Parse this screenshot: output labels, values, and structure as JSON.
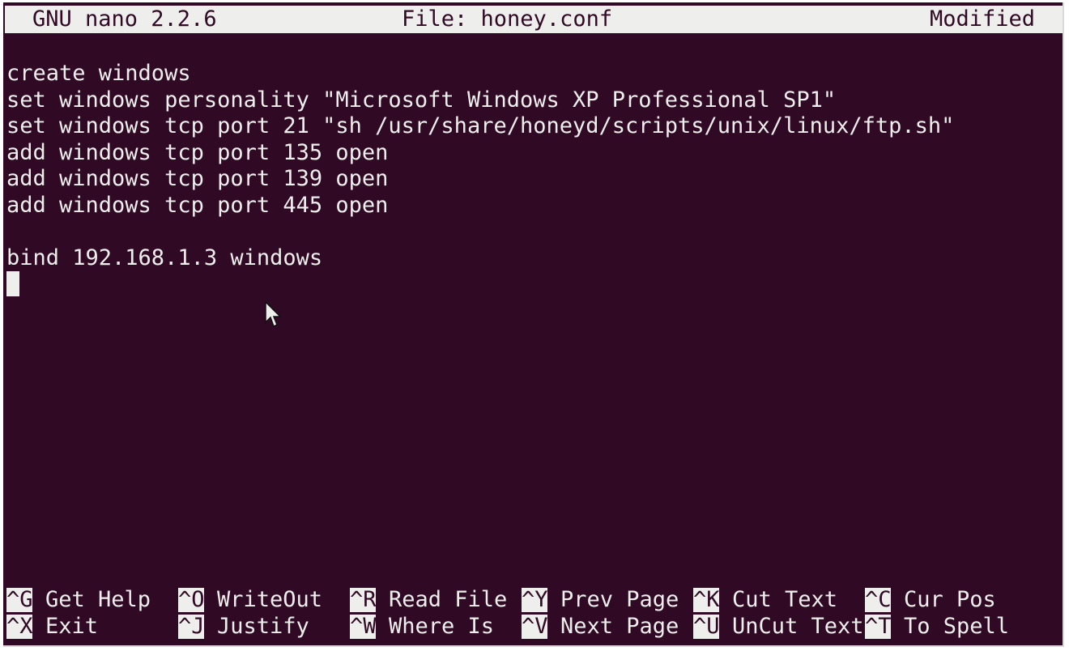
{
  "title_bar": {
    "app": "GNU nano 2.2.6",
    "file": "File: honey.conf",
    "status": "Modified"
  },
  "editor": {
    "lines": [
      "create windows",
      "set windows personality \"Microsoft Windows XP Professional SP1\"",
      "set windows tcp port 21 \"sh /usr/share/honeyd/scripts/unix/linux/ftp.sh\"",
      "add windows tcp port 135 open",
      "add windows tcp port 139 open",
      "add windows tcp port 445 open",
      "",
      "bind 192.168.1.3 windows"
    ]
  },
  "shortcuts": {
    "row1": [
      {
        "key": "^G",
        "label": "Get Help"
      },
      {
        "key": "^O",
        "label": "WriteOut"
      },
      {
        "key": "^R",
        "label": "Read File"
      },
      {
        "key": "^Y",
        "label": "Prev Page"
      },
      {
        "key": "^K",
        "label": "Cut Text"
      },
      {
        "key": "^C",
        "label": "Cur Pos"
      }
    ],
    "row2": [
      {
        "key": "^X",
        "label": "Exit"
      },
      {
        "key": "^J",
        "label": "Justify"
      },
      {
        "key": "^W",
        "label": "Where Is"
      },
      {
        "key": "^V",
        "label": "Next Page"
      },
      {
        "key": "^U",
        "label": "UnCut Text"
      },
      {
        "key": "^T",
        "label": "To Spell"
      }
    ]
  },
  "colors": {
    "background": "#300a24",
    "foreground": "#eeeeec"
  }
}
